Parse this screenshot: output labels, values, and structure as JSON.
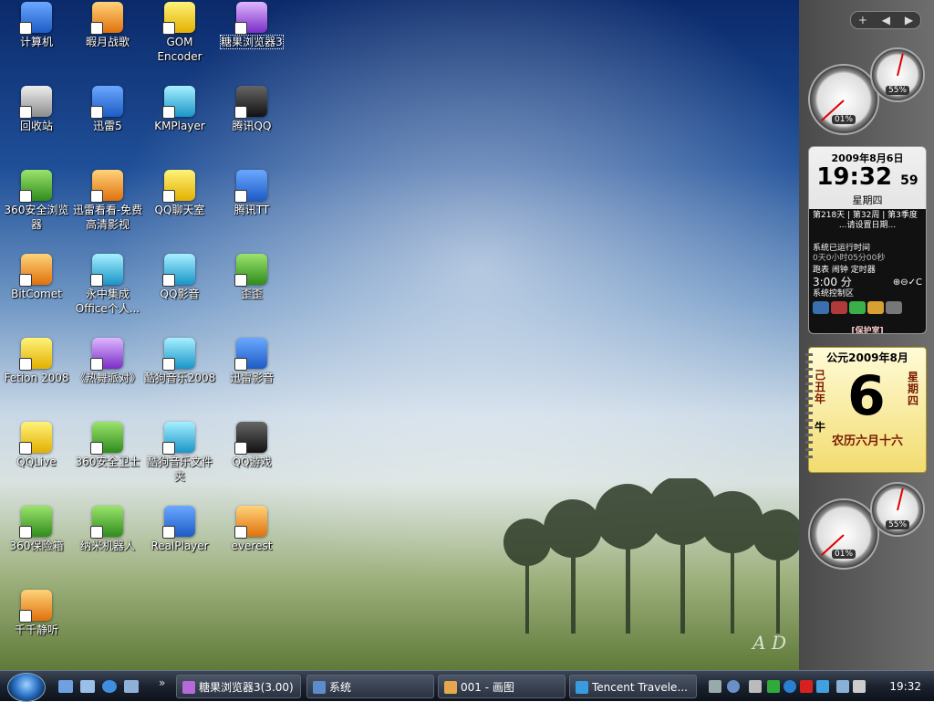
{
  "desktop": {
    "watermark": "A D",
    "icons": [
      {
        "label": "计算机",
        "color": "g-blue"
      },
      {
        "label": "暇月战歌",
        "color": "g-orange"
      },
      {
        "label": "GOM Encoder",
        "color": "g-yellow"
      },
      {
        "label": "糖果浏览器3",
        "color": "g-purple",
        "selected": true
      },
      {
        "label": "回收站",
        "color": "g-gray"
      },
      {
        "label": "迅雷5",
        "color": "g-blue"
      },
      {
        "label": "KMPlayer",
        "color": "g-cyan"
      },
      {
        "label": "腾讯QQ",
        "color": "g-black"
      },
      {
        "label": "360安全浏览器",
        "color": "g-green"
      },
      {
        "label": "迅雷看看-免费高清影视",
        "color": "g-orange"
      },
      {
        "label": "QQ聊天室",
        "color": "g-yellow"
      },
      {
        "label": "腾讯TT",
        "color": "g-blue"
      },
      {
        "label": "BitComet",
        "color": "g-orange"
      },
      {
        "label": "永中集成Office个人...",
        "color": "g-cyan"
      },
      {
        "label": "QQ影音",
        "color": "g-cyan"
      },
      {
        "label": "歪歪",
        "color": "g-green"
      },
      {
        "label": "Fetion 2008",
        "color": "g-yellow"
      },
      {
        "label": "《热舞派对》",
        "color": "g-purple"
      },
      {
        "label": "酷狗音乐2008",
        "color": "g-cyan"
      },
      {
        "label": "迅雷影音",
        "color": "g-blue"
      },
      {
        "label": "QQLive",
        "color": "g-yellow"
      },
      {
        "label": "360安全卫士",
        "color": "g-green"
      },
      {
        "label": "酷狗音乐文件夹",
        "color": "g-cyan"
      },
      {
        "label": "QQ游戏",
        "color": "g-black"
      },
      {
        "label": "360保险箱",
        "color": "g-green"
      },
      {
        "label": "纳米机器人",
        "color": "g-green"
      },
      {
        "label": "RealPlayer",
        "color": "g-blue"
      },
      {
        "label": "everest",
        "color": "g-orange"
      },
      {
        "label": "千千静听",
        "color": "g-orange"
      }
    ]
  },
  "sidebar": {
    "controls": [
      "+",
      "◀",
      "▶"
    ],
    "gauges_top": {
      "cpu": "01%",
      "mem": "55%",
      "cpu_level": 1,
      "mem_level": 55
    },
    "gauges_bottom": {
      "cpu": "01%",
      "mem": "55%",
      "cpu_level": 1,
      "mem_level": 55
    },
    "clock": {
      "date": "2009年8月6日",
      "time": "19:32",
      "seconds": "59",
      "weekday": "星期四",
      "stats": "第218天 | 第32周 | 第3季度",
      "hint": "...请设置日期...",
      "uptime_label": "系统已运行时间",
      "uptime": "0天0小时05分00秒",
      "tools": "跑表  闹钟  定时器",
      "timer": "3:00 分",
      "timer_ctrls": "⊕⊖✓C",
      "control_label": "系统控制区",
      "protect": "[保护室]"
    },
    "calendar": {
      "header": "公元2009年8月",
      "day": "6",
      "year_gz": "己丑年",
      "zodiac": "牛",
      "weekday": "星期四",
      "lunar": "农历六月十六"
    }
  },
  "taskbar": {
    "quicklaunch_more": "»",
    "tasks": [
      {
        "label": "糖果浏览器3(3.00)"
      },
      {
        "label": "系统"
      },
      {
        "label": "001 - 画图"
      },
      {
        "label": "Tencent Travele..."
      }
    ],
    "clock": "19:32"
  }
}
